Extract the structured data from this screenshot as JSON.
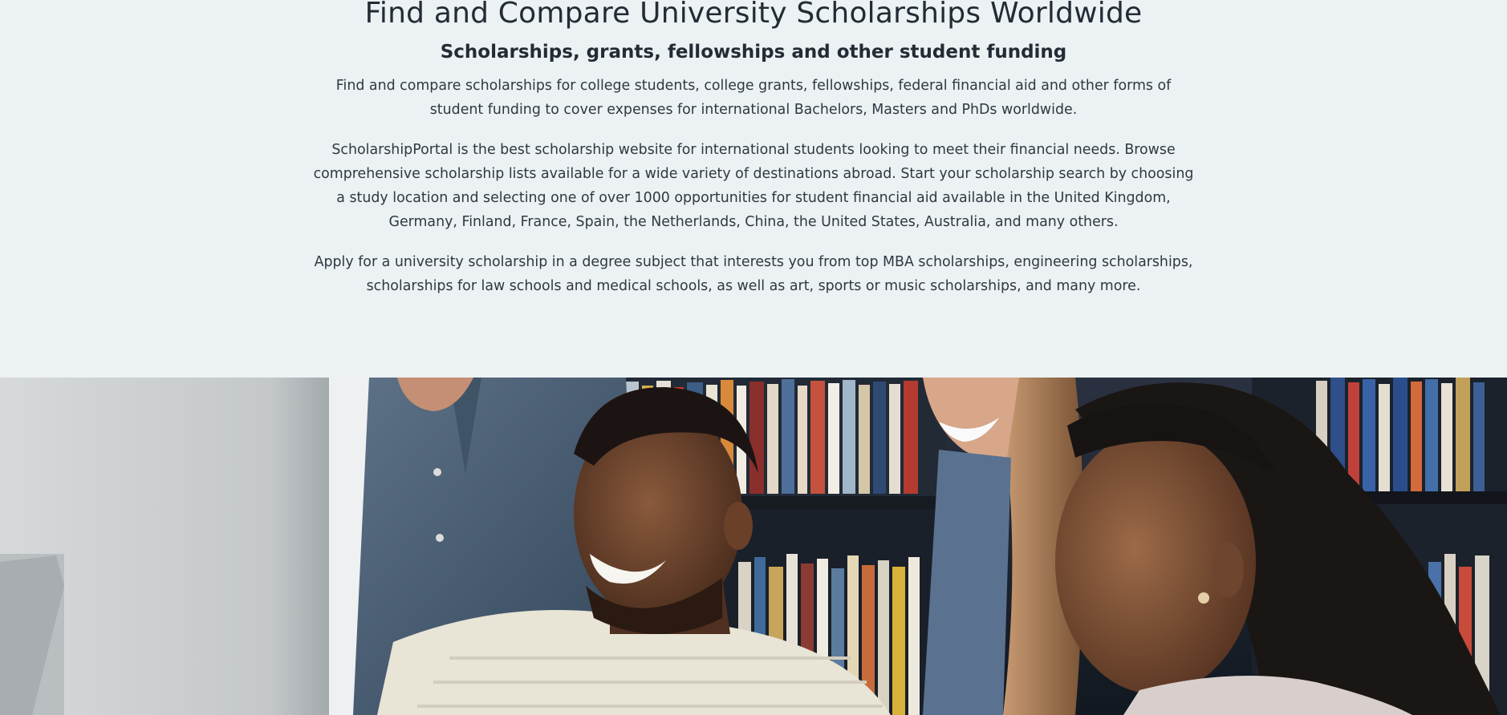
{
  "header": {
    "title": "Find and Compare University Scholarships Worldwide",
    "subtitle": "Scholarships, grants, fellowships and other student funding"
  },
  "intro": {
    "paragraphs": [
      "Find and compare scholarships for college students, college grants, fellowships, federal financial aid and other forms of student funding to cover expenses for international Bachelors, Masters and PhDs worldwide.",
      "ScholarshipPortal is the best scholarship website for international students looking to meet their financial needs. Browse comprehensive scholarship lists available for a wide variety of destinations abroad. Start your scholarship search by choosing a study location and selecting one of over 1000 opportunities for student financial aid available in the United Kingdom, Germany, Finland, France, Spain, the Netherlands, China, the United States, Australia, and many others.",
      "Apply for a university scholarship in a degree subject that interests you from top MBA scholarships, engineering scholarships, scholarships for law schools and medical schools, as well as art, sports or music scholarships, and many more."
    ]
  },
  "hero_image": {
    "icon": "students-photo",
    "colors": {
      "background": "#ecf1f3",
      "text": "#232c35"
    }
  }
}
